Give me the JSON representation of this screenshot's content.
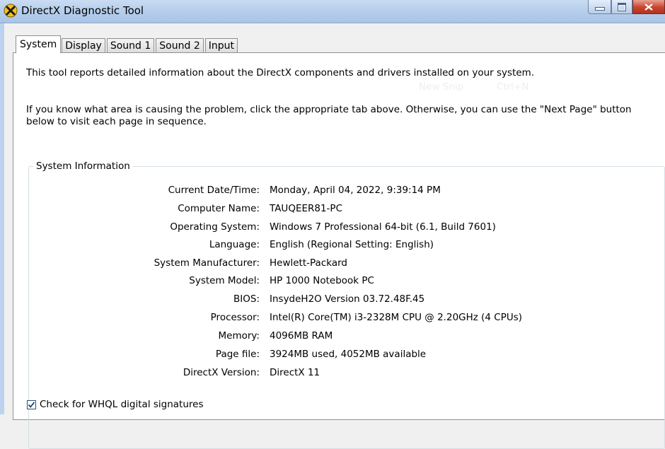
{
  "window": {
    "title": "DirectX Diagnostic Tool",
    "icon": "directx-icon",
    "controls": [
      "minimize",
      "maximize",
      "close"
    ]
  },
  "tabs": [
    {
      "label": "System",
      "active": true
    },
    {
      "label": "Display",
      "active": false
    },
    {
      "label": "Sound 1",
      "active": false
    },
    {
      "label": "Sound 2",
      "active": false
    },
    {
      "label": "Input",
      "active": false
    }
  ],
  "intro": {
    "line1": "This tool reports detailed information about the DirectX components and drivers installed on your system.",
    "line2": "If you know what area is causing the problem, click the appropriate tab above.  Otherwise, you can use the \"Next Page\" button below to visit each page in sequence."
  },
  "ghost_menu": {
    "new_snip": "New Snip",
    "shortcut": "Ctrl+N"
  },
  "system_info": {
    "title": "System Information",
    "rows": [
      {
        "label": "Current Date/Time:",
        "value": "Monday, April 04, 2022, 9:39:14 PM"
      },
      {
        "label": "Computer Name:",
        "value": "TAUQEER81-PC"
      },
      {
        "label": "Operating System:",
        "value": "Windows 7 Professional 64-bit (6.1, Build 7601)"
      },
      {
        "label": "Language:",
        "value": "English (Regional Setting: English)"
      },
      {
        "label": "System Manufacturer:",
        "value": "Hewlett-Packard"
      },
      {
        "label": "System Model:",
        "value": "HP 1000 Notebook PC"
      },
      {
        "label": "BIOS:",
        "value": "InsydeH2O Version 03.72.48F.45"
      },
      {
        "label": "Processor:",
        "value": "Intel(R) Core(TM) i3-2328M CPU @ 2.20GHz (4 CPUs)"
      },
      {
        "label": "Memory:",
        "value": "4096MB RAM"
      },
      {
        "label": "Page file:",
        "value": "3924MB used, 4052MB available"
      },
      {
        "label": "DirectX Version:",
        "value": "DirectX 11"
      }
    ]
  },
  "whql": {
    "label": "Check for WHQL digital signatures",
    "checked": true
  },
  "colors": {
    "titlebar": "#b7cfec",
    "close_button": "#c7452f",
    "panel_bg": "#ffffff"
  }
}
